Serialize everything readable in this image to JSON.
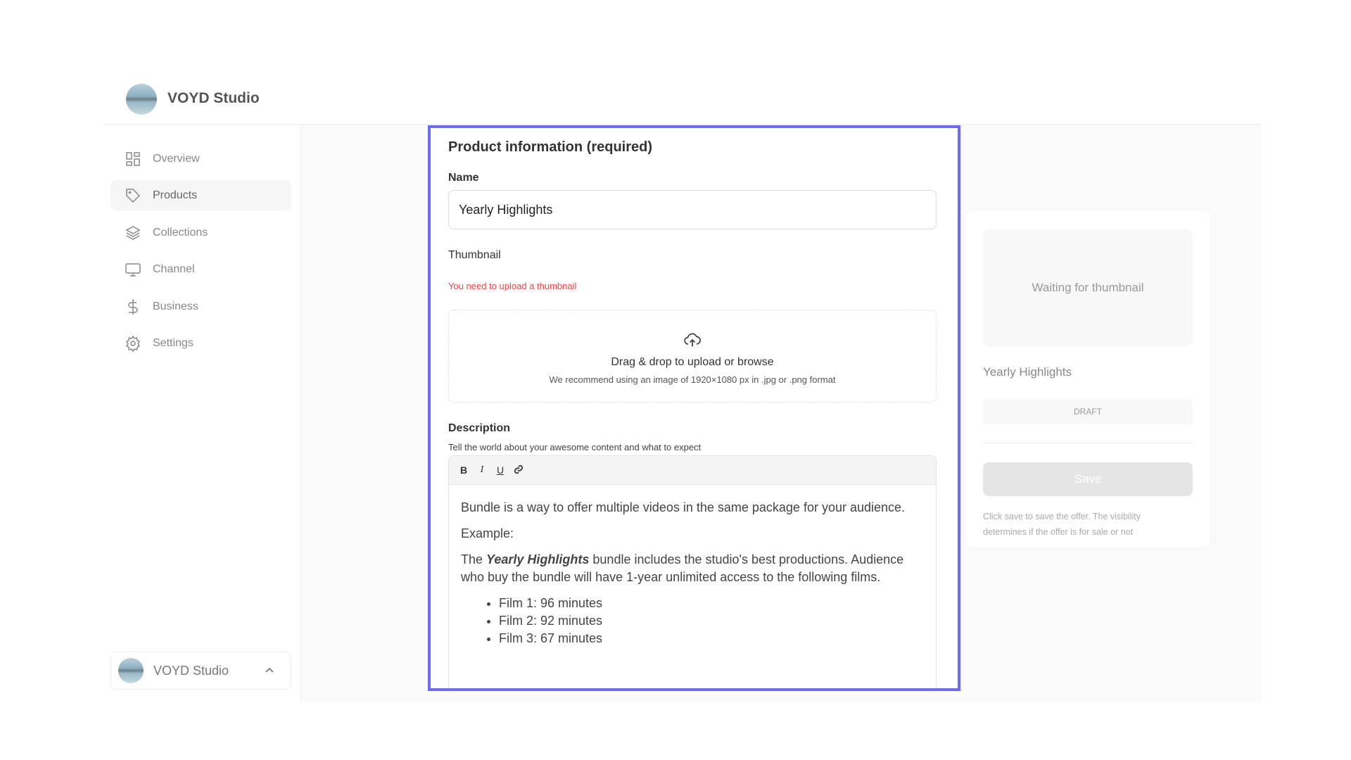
{
  "brand": {
    "name": "VOYD Studio"
  },
  "sidebar": {
    "items": [
      {
        "label": "Overview",
        "icon": "grid-icon"
      },
      {
        "label": "Products",
        "icon": "tag-icon",
        "active": true
      },
      {
        "label": "Collections",
        "icon": "layers-icon"
      },
      {
        "label": "Channel",
        "icon": "monitor-icon"
      },
      {
        "label": "Business",
        "icon": "dollar-icon"
      },
      {
        "label": "Settings",
        "icon": "gear-icon"
      }
    ],
    "account": {
      "name": "VOYD Studio",
      "icon": "chevron-up-icon"
    }
  },
  "form": {
    "title": "Product information (required)",
    "name_label": "Name",
    "name_value": "Yearly Highlights",
    "thumbnail_label": "Thumbnail",
    "thumbnail_error": "You need to upload a thumbnail",
    "drop_title": "Drag & drop to upload or browse",
    "drop_hint": "We recommend using an image of 1920×1080 px in .jpg or .png format",
    "description_label": "Description",
    "description_hint": "Tell the world about your awesome content and what to expect",
    "toolbar": {
      "bold": "B",
      "italic": "I",
      "underline": "U",
      "link_icon": "link-icon"
    },
    "content": {
      "p1": "Bundle is a way to offer multiple videos in the same package for your audience.",
      "p2": "Example:",
      "p3_pre": "The ",
      "p3_em": "Yearly Highlights",
      "p3_post": " bundle includes the studio's best productions. Audience who buy the bundle will have 1-year unlimited access to the following films.",
      "list": [
        "Film 1: 96 minutes",
        "Film 2: 92 minutes",
        "Film 3: 67 minutes"
      ]
    }
  },
  "preview": {
    "thumb_placeholder": "Waiting for thumbnail",
    "title": "Yearly Highlights",
    "status": "DRAFT",
    "save_label": "Save",
    "help": "Click save to save the offer. The visibility determines if the offer is for sale or not"
  },
  "colors": {
    "accent": "#6b6bf5",
    "error": "#ef4444"
  }
}
